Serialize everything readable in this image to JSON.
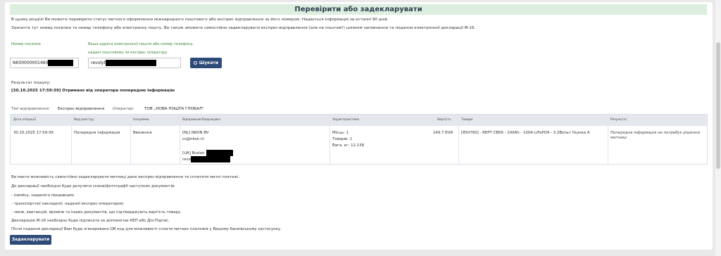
{
  "page_title": "Перевірити або задекларувати",
  "intro": {
    "line1": "В цьому розділі Ви можете перевірити статус митного оформлення міжнародного поштового або експрес відправлення за його номером. Надається інформація за останні 90 днів.",
    "line2": "Зазначте тут номер посилки та номер телефону або електронну пошту, Ви також зможете самостійно задекларувати експрес-відправлення (але не поштові!) шляхом заповнення та подання електронної декларації М-16."
  },
  "form": {
    "parcel_label": "Номер посилки",
    "parcel_value": "NK00000001460",
    "contact_label_1": "Ваша адреса електронної пошти або номер телефону,",
    "contact_label_2": "надані поштовому чи експрес оператору",
    "contact_value": "revolyt",
    "search_label": "Шукати"
  },
  "result": {
    "label": "Результат пошуку:",
    "status": "[30.10.2025 17:59:39] Отримано від оператора попередню інформацію"
  },
  "shipment": {
    "type_label": "Тип відправлення:",
    "type_value": "Експрес-відправлення",
    "operator_label": "Оператор:",
    "operator_value": "ТОВ „НОВА ПОШТА ГЛОБАЛ\""
  },
  "table": {
    "headers": [
      "Дата операції",
      "Вид реєстру",
      "Напрямок",
      "Відправник/Одержувач",
      "Характеристики",
      "Вартість",
      "Товари",
      "Результат"
    ],
    "row": {
      "date": "30.10.2025 17:59:39",
      "registry": "Попередня інформація",
      "direction": "Ввезення",
      "sender_name": "[NL] NKON BV",
      "sender_email": "cs@nkon.nl",
      "recipient_name": "[UA] Ruslan",
      "recipient_email": "revo",
      "places": "Місць: 1",
      "goods_count": "Товарів: 1",
      "weight": "Вага, кг: 12.138",
      "value": "149.7 EUR",
      "goods": "[850760] - REPT CB56 - 100Ah - 100A LiFePO4 - 3.2Вольт Оцінка А",
      "result": "Попередня інформація не потребує рішення митниці"
    }
  },
  "info": {
    "p1": "Ви маєте можливість самостійно задекларувати митниці дане експрес-відправлення та сплатити митні платежі.",
    "p2": "До декларації необхідно буде долучити скани/фотографії наступних документів:",
    "p3": "- інвойсу, наданого продавцем;",
    "p4": "- транспортної накладної, наданої експрес-оператором;",
    "p5": "- чеків, квитанцій, ярликів та інших документів, що підтверджують вартість товару.",
    "p6": "Декларацію М-16 необхідно буде підписати за допомогою КЕП або Дія.Підпис.",
    "p7": "Після подання декларації Вам буде згенеровано QR код для можливості сплати митних платежів у Вашому банківському застосунку."
  },
  "declare_label": "Задекларувати"
}
